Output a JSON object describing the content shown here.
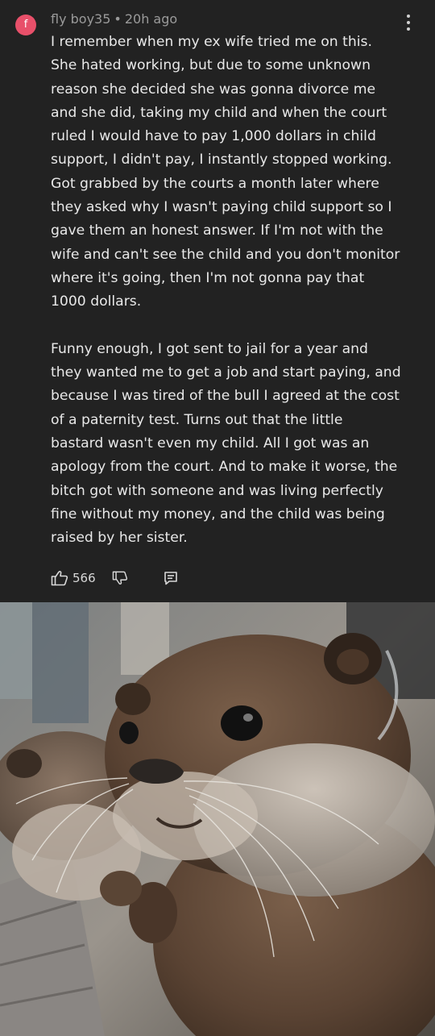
{
  "comment": {
    "avatar_letter": "f",
    "username": "fly boy35",
    "separator": "•",
    "time_ago": "20h ago",
    "menu_icon": "kebab-menu-icon",
    "paragraphs": [
      {
        "lines": [
          "I remember when my ex wife tried me on this.",
          "She hated working, but due to some unknown",
          "reason she decided she was gonna divorce me",
          "and she did, taking my child and when the court",
          "ruled I would have to pay 1,000 dollars in child",
          "support, I didn't pay, I instantly stopped working.",
          "Got grabbed by the courts a month later where",
          "they asked why I wasn't paying child support so I",
          "gave them an honest answer. If I'm not with the",
          "wife and can't see the child and you don't monitor",
          "where it's going, then I'm not gonna pay that",
          "1000 dollars."
        ]
      },
      {
        "lines": [
          "Funny enough, I got sent to jail for a year and",
          "they wanted me to get a job and start paying, and",
          "because I was tired of the bull I agreed at the cost",
          "of a paternity test. Turns out that the little",
          "bastard wasn't even my child. All I got was an",
          "apology from the court. And to make it worse, the",
          "bitch got with someone and was living perfectly",
          "fine without my money, and the child was being",
          "raised by her sister."
        ]
      }
    ],
    "actions": {
      "like_icon": "thumbs-up-icon",
      "like_count": "566",
      "dislike_icon": "thumbs-down-icon",
      "reply_icon": "reply-comment-icon"
    }
  },
  "colors": {
    "background": "#222222",
    "text": "#e8e8e8",
    "meta": "#9a9a9a",
    "avatar": "#e8506a"
  },
  "image": {
    "subject_icon": "otter-photo"
  }
}
